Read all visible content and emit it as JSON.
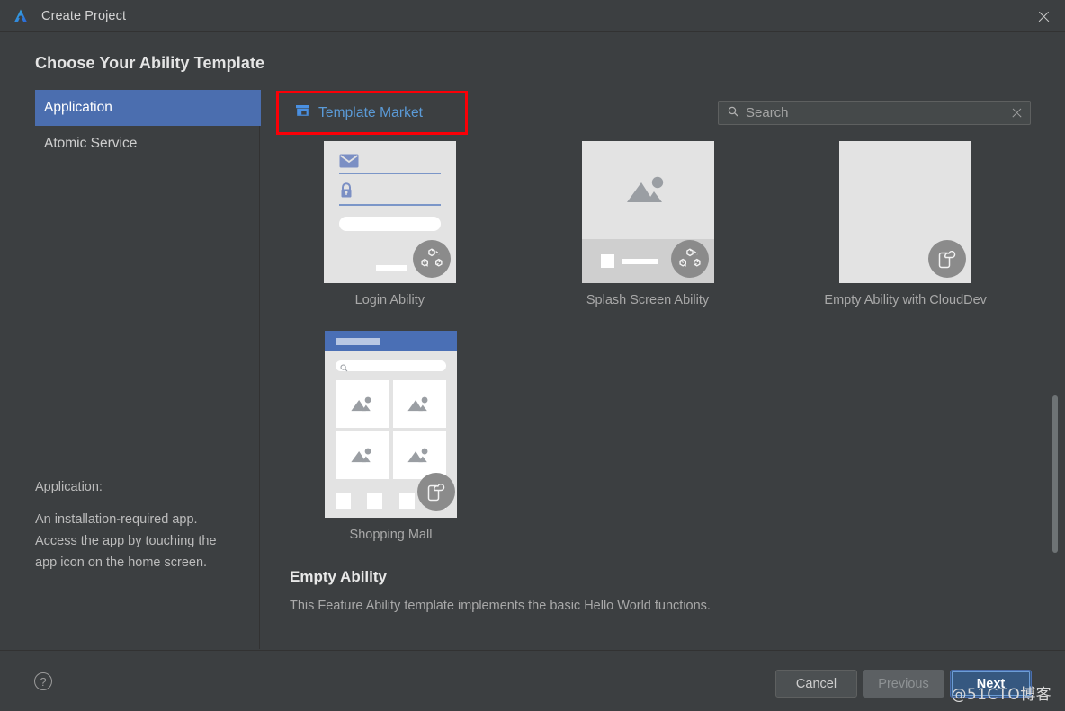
{
  "window": {
    "title": "Create Project",
    "logo_icon": "deveco-logo-icon",
    "close_icon": "close-icon"
  },
  "page": {
    "heading": "Choose Your Ability Template"
  },
  "sidebar": {
    "items": [
      {
        "label": "Application",
        "selected": true
      },
      {
        "label": "Atomic Service",
        "selected": false
      }
    ],
    "description": {
      "term": "Application:",
      "line1": "An installation-required app.",
      "line2": "Access the app by touching the",
      "line3": "app icon on the home screen."
    }
  },
  "toolbar": {
    "template_market_label": "Template Market",
    "template_market_icon": "store-icon",
    "template_market_color": "#5b9bd8",
    "annotation_box_color": "#fb0007"
  },
  "search": {
    "icon": "search-icon",
    "placeholder": "Search",
    "value": "",
    "clear_icon": "close-icon"
  },
  "templates": [
    {
      "label": "Login Ability",
      "thumb": "login-ability-thumbnail",
      "badge_icon": "distributed-share-icon"
    },
    {
      "label": "Splash Screen Ability",
      "thumb": "splash-screen-ability-thumbnail",
      "badge_icon": "distributed-share-icon"
    },
    {
      "label": "Empty Ability with CloudDev",
      "thumb": "empty-ability-clouddev-thumbnail",
      "badge_icon": "phone-cloud-icon"
    },
    {
      "label": "Shopping Mall",
      "thumb": "shopping-mall-thumbnail",
      "badge_icon": "phone-cloud-icon"
    }
  ],
  "selection": {
    "title": "Empty Ability",
    "description": "This Feature Ability template implements the basic Hello World functions."
  },
  "footer": {
    "help_icon": "question-mark-icon",
    "help_label": "?",
    "buttons": [
      {
        "label": "Cancel",
        "state": "normal"
      },
      {
        "label": "Previous",
        "state": "disabled"
      },
      {
        "label": "Next",
        "state": "primary"
      }
    ]
  },
  "watermark": {
    "text": "@51CTO博客"
  },
  "colors": {
    "window_bg": "#3c3f41",
    "selection_blue": "#4b6eaf",
    "primary_button": "#365880",
    "link_blue": "#5b9bd8",
    "annotation_red": "#fb0007",
    "thumb_bg": "#e3e3e3"
  }
}
